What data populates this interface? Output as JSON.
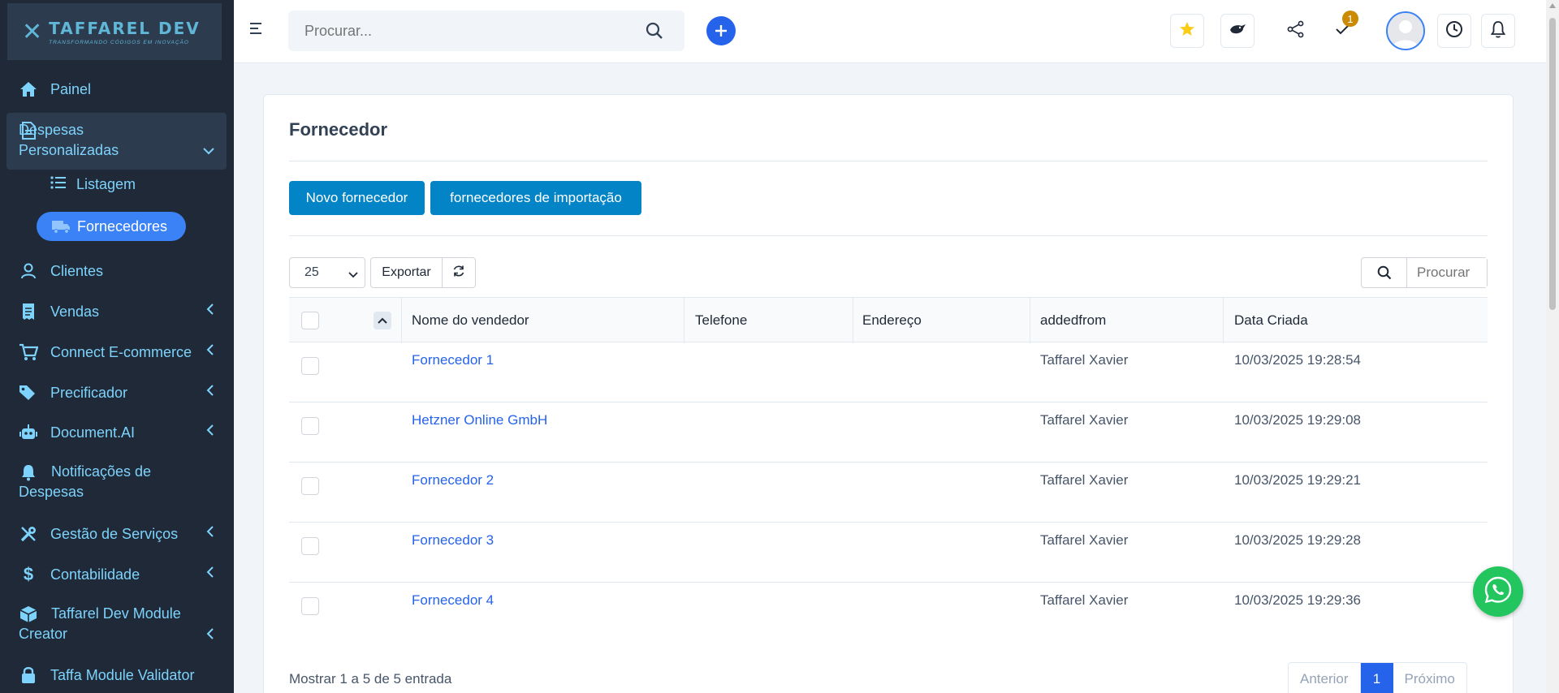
{
  "brand": {
    "name": "TAFFAREL DEV",
    "tagline": "TRANSFORMANDO CÓDIGOS EM INOVAÇÃO"
  },
  "sidebar": {
    "items": [
      {
        "label": "Painel",
        "icon": "home-icon"
      },
      {
        "label": "Despesas Personalizadas",
        "icon": "document-icon",
        "expanded": true
      },
      {
        "label": "Listagem",
        "icon": "list-icon"
      },
      {
        "label": "Fornecedores",
        "icon": "truck-icon",
        "active": true
      },
      {
        "label": "Clientes",
        "icon": "user-icon"
      },
      {
        "label": "Vendas",
        "icon": "receipt-icon"
      },
      {
        "label": "Connect E-commerce",
        "icon": "cart-icon"
      },
      {
        "label": "Precificador",
        "icon": "tags-icon"
      },
      {
        "label": "Document.AI",
        "icon": "robot-icon"
      },
      {
        "label": "Notificações de Despesas",
        "icon": "bell-icon"
      },
      {
        "label": "Gestão de Serviços",
        "icon": "tools-icon"
      },
      {
        "label": "Contabilidade",
        "icon": "dollar-icon"
      },
      {
        "label": "Taffarel Dev Module Creator",
        "icon": "box-icon"
      },
      {
        "label": "Taffa Module Validator",
        "icon": "lock-icon"
      }
    ]
  },
  "topbar": {
    "search_placeholder": "Procurar...",
    "todo_badge": "1"
  },
  "page": {
    "title": "Fornecedor",
    "new_button": "Novo fornecedor",
    "import_button": "fornecedores de importação",
    "page_size": "25",
    "export_button": "Exportar",
    "table_search_placeholder": "Procurar"
  },
  "table": {
    "columns": [
      "Nome do vendedor",
      "Telefone",
      "Endereço",
      "addedfrom",
      "Data Criada"
    ],
    "rows": [
      {
        "name": "Fornecedor 1",
        "phone": "",
        "address": "",
        "added_from": "Taffarel Xavier",
        "created": "10/03/2025 19:28:54"
      },
      {
        "name": "Hetzner Online GmbH",
        "phone": "",
        "address": "",
        "added_from": "Taffarel Xavier",
        "created": "10/03/2025 19:29:08"
      },
      {
        "name": "Fornecedor 2",
        "phone": "",
        "address": "",
        "added_from": "Taffarel Xavier",
        "created": "10/03/2025 19:29:21"
      },
      {
        "name": "Fornecedor 3",
        "phone": "",
        "address": "",
        "added_from": "Taffarel Xavier",
        "created": "10/03/2025 19:29:28"
      },
      {
        "name": "Fornecedor 4",
        "phone": "",
        "address": "",
        "added_from": "Taffarel Xavier",
        "created": "10/03/2025 19:29:36"
      }
    ]
  },
  "footer": {
    "info": "Mostrar 1 a 5 de 5 entrada",
    "prev": "Anterior",
    "current_page": "1",
    "next": "Próximo"
  },
  "colors": {
    "sidebar_bg": "#1f2937",
    "accent": "#2563eb",
    "primary_button": "#0284c7",
    "whatsapp": "#22c55e"
  }
}
